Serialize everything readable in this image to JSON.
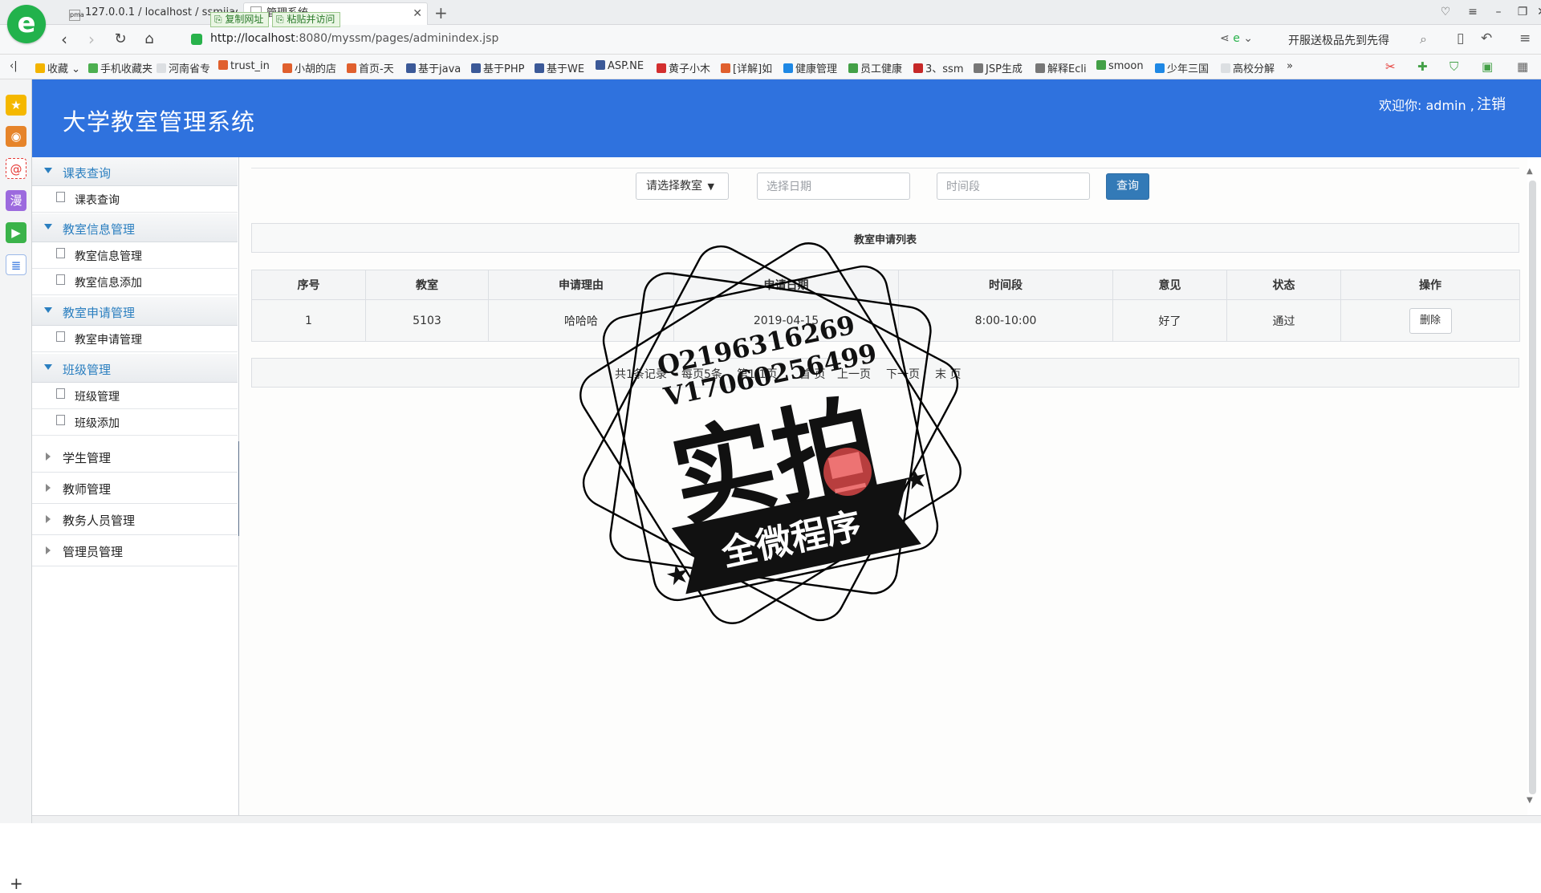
{
  "browser": {
    "tabs": [
      {
        "label": "127.0.0.1 / localhost / ssmjiao"
      },
      {
        "label": "管理系统"
      }
    ],
    "tooltips": {
      "copy_url": "复制网址",
      "paste_go": "粘贴并访问"
    },
    "url_host": "http://localhost",
    "url_rest": ":8080/myssm/pages/adminindex.jsp",
    "news": "开服送极品先到先得",
    "bookmarks": [
      {
        "label": "收藏",
        "color": "#f3b400"
      },
      {
        "label": "手机收藏夹",
        "color": "#4caf50"
      },
      {
        "label": "河南省专",
        "color": "#9aa0a6"
      },
      {
        "label": "trust_in",
        "color": "#e0602e"
      },
      {
        "label": "小胡的店",
        "color": "#e0602e"
      },
      {
        "label": "首页-天",
        "color": "#e0602e"
      },
      {
        "label": "基于java",
        "color": "#3b5998"
      },
      {
        "label": "基于PHP",
        "color": "#3b5998"
      },
      {
        "label": "基于WE",
        "color": "#3b5998"
      },
      {
        "label": "ASP.NE",
        "color": "#3b5998"
      },
      {
        "label": "黄子小木",
        "color": "#d32f2f"
      },
      {
        "label": "[详解]如",
        "color": "#e0602e"
      },
      {
        "label": "健康管理",
        "color": "#1e88e5"
      },
      {
        "label": "员工健康",
        "color": "#43a047"
      },
      {
        "label": "3、ssm",
        "color": "#c62828"
      },
      {
        "label": "JSP生成",
        "color": "#555555"
      },
      {
        "label": "解释Ecli",
        "color": "#555555"
      },
      {
        "label": "smoon",
        "color": "#43a047"
      },
      {
        "label": "少年三国",
        "color": "#1e88e5"
      },
      {
        "label": "高校分解",
        "color": "#9aa0a6"
      }
    ],
    "bookmark_more": "»"
  },
  "app": {
    "title": "大学教室管理系统",
    "welcome": "欢迎你: admin ,",
    "logout": "注销",
    "accent": "#2f72de"
  },
  "sidebar": {
    "groups": [
      {
        "label": "课表查询",
        "items": [
          "课表查询"
        ]
      },
      {
        "label": "教室信息管理",
        "items": [
          "教室信息管理",
          "教室信息添加"
        ]
      },
      {
        "label": "教室申请管理",
        "items": [
          "教室申请管理"
        ]
      },
      {
        "label": "班级管理",
        "items": [
          "班级管理",
          "班级添加"
        ]
      }
    ],
    "collapsed": [
      "学生管理",
      "教师管理",
      "教务人员管理",
      "管理员管理"
    ]
  },
  "search": {
    "classroom_select": "请选择教室",
    "date_placeholder": "选择日期",
    "time_placeholder": "时间段",
    "query_button": "查询"
  },
  "list": {
    "title": "教室申请列表",
    "columns": [
      "序号",
      "教室",
      "申请理由",
      "申请日期",
      "时间段",
      "意见",
      "状态",
      "操作"
    ],
    "rows": [
      {
        "no": "1",
        "room": "5103",
        "reason": "哈哈哈",
        "date": "2019-04-15",
        "time": "8:00-10:00",
        "opinion": "好了",
        "status": "通过",
        "action": "删除"
      }
    ]
  },
  "pager": {
    "total": "共1条记录",
    "per_page": "每页5条",
    "page": "第1/1页",
    "first": "首 页",
    "prev": "上一页",
    "next": "下一页",
    "last": "末 页"
  },
  "watermark": {
    "line1": "Q2196316269",
    "line2": "V17060256499",
    "main": "实拍",
    "banner": "全微程序"
  }
}
